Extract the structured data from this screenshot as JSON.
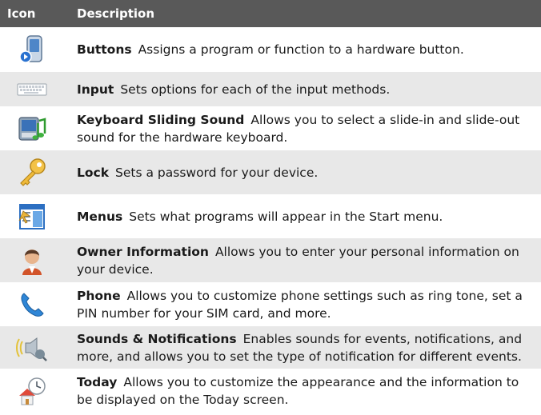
{
  "header": {
    "col_icon": "Icon",
    "col_description": "Description"
  },
  "rows": [
    {
      "icon": "buttons-icon",
      "title": "Buttons",
      "text": "Assigns a program or function to a hardware button."
    },
    {
      "icon": "input-icon",
      "title": "Input",
      "text": "Sets options for each of the input methods."
    },
    {
      "icon": "keyboard-sliding-sound-icon",
      "title": "Keyboard Sliding Sound",
      "text": "Allows you to select a slide-in and slide-out sound for the hardware keyboard."
    },
    {
      "icon": "lock-icon",
      "title": "Lock",
      "text": "Sets a password for your device."
    },
    {
      "icon": "menus-icon",
      "title": "Menus",
      "text": "Sets what programs will appear in the Start menu."
    },
    {
      "icon": "owner-information-icon",
      "title": "Owner Information",
      "text": "Allows you to enter your personal information on your device."
    },
    {
      "icon": "phone-icon",
      "title": "Phone",
      "text": "Allows you to customize phone settings such as ring tone, set a PIN number for your SIM card, and more."
    },
    {
      "icon": "sounds-notifications-icon",
      "title": "Sounds & Notifications",
      "text": "Enables sounds for events, notifications, and more, and allows you to set the type of notification for different events."
    },
    {
      "icon": "today-icon",
      "title": "Today",
      "text": "Allows you to customize the appearance and the information to be displayed on the Today screen."
    }
  ],
  "colors": {
    "header_bg": "#595959",
    "header_text": "#ffffff",
    "shaded_row": "#e8e8e8"
  }
}
